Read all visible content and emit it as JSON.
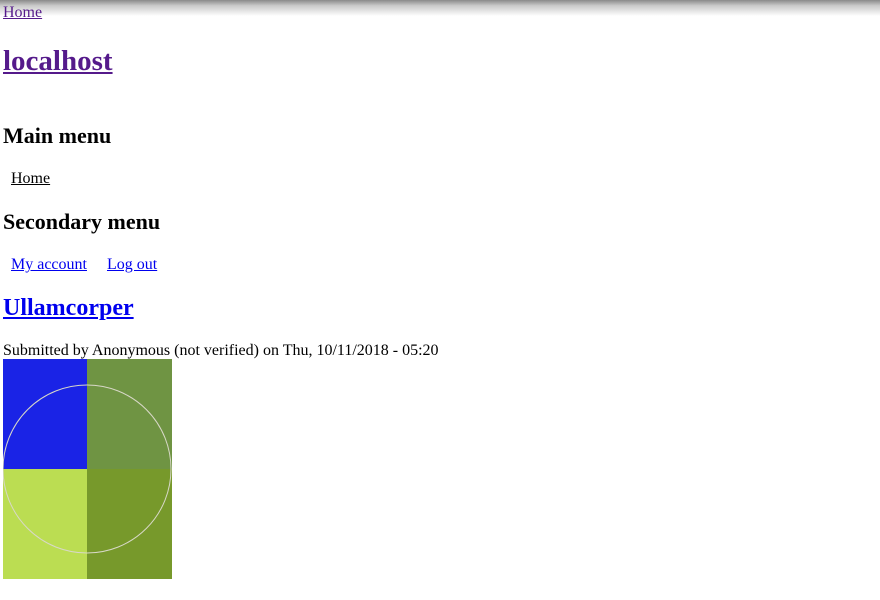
{
  "skip_link": {
    "label": "Home"
  },
  "header": {
    "site_name": "localhost"
  },
  "main_menu": {
    "heading": "Main menu",
    "items": [
      {
        "label": "Home"
      }
    ]
  },
  "secondary_menu": {
    "heading": "Secondary menu",
    "items": [
      {
        "label": "My account"
      },
      {
        "label": "Log out"
      }
    ]
  },
  "article": {
    "title": "Ullamcorper",
    "submitted": "Submitted by Anonymous (not verified) on Thu, 10/11/2018 - 05:20",
    "image": {
      "colors": {
        "top_left": "#1a23e6",
        "top_right": "#6f9443",
        "bottom_left": "#bbdd52",
        "bottom_right": "#77992b",
        "circle": "#d8d8c8"
      }
    }
  },
  "colors": {
    "visited_link": "#551a8b",
    "link": "#0000ee",
    "text": "#000000"
  }
}
